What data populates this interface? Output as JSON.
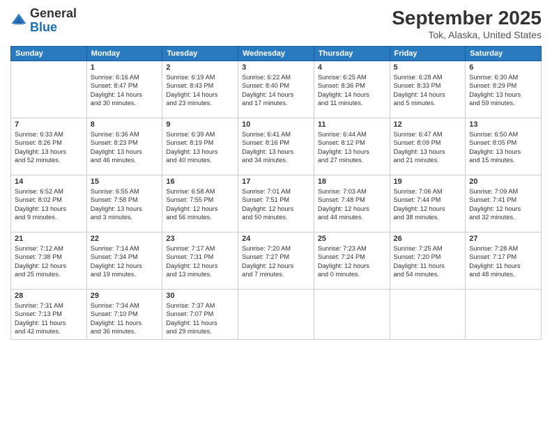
{
  "header": {
    "logo_general": "General",
    "logo_blue": "Blue",
    "title": "September 2025",
    "subtitle": "Tok, Alaska, United States"
  },
  "days_of_week": [
    "Sunday",
    "Monday",
    "Tuesday",
    "Wednesday",
    "Thursday",
    "Friday",
    "Saturday"
  ],
  "weeks": [
    [
      {
        "day": "",
        "info": ""
      },
      {
        "day": "1",
        "info": "Sunrise: 6:16 AM\nSunset: 8:47 PM\nDaylight: 14 hours\nand 30 minutes."
      },
      {
        "day": "2",
        "info": "Sunrise: 6:19 AM\nSunset: 8:43 PM\nDaylight: 14 hours\nand 23 minutes."
      },
      {
        "day": "3",
        "info": "Sunrise: 6:22 AM\nSunset: 8:40 PM\nDaylight: 14 hours\nand 17 minutes."
      },
      {
        "day": "4",
        "info": "Sunrise: 6:25 AM\nSunset: 8:36 PM\nDaylight: 14 hours\nand 11 minutes."
      },
      {
        "day": "5",
        "info": "Sunrise: 6:28 AM\nSunset: 8:33 PM\nDaylight: 14 hours\nand 5 minutes."
      },
      {
        "day": "6",
        "info": "Sunrise: 6:30 AM\nSunset: 8:29 PM\nDaylight: 13 hours\nand 59 minutes."
      }
    ],
    [
      {
        "day": "7",
        "info": "Sunrise: 6:33 AM\nSunset: 8:26 PM\nDaylight: 13 hours\nand 52 minutes."
      },
      {
        "day": "8",
        "info": "Sunrise: 6:36 AM\nSunset: 8:23 PM\nDaylight: 13 hours\nand 46 minutes."
      },
      {
        "day": "9",
        "info": "Sunrise: 6:39 AM\nSunset: 8:19 PM\nDaylight: 13 hours\nand 40 minutes."
      },
      {
        "day": "10",
        "info": "Sunrise: 6:41 AM\nSunset: 8:16 PM\nDaylight: 13 hours\nand 34 minutes."
      },
      {
        "day": "11",
        "info": "Sunrise: 6:44 AM\nSunset: 8:12 PM\nDaylight: 13 hours\nand 27 minutes."
      },
      {
        "day": "12",
        "info": "Sunrise: 6:47 AM\nSunset: 8:09 PM\nDaylight: 13 hours\nand 21 minutes."
      },
      {
        "day": "13",
        "info": "Sunrise: 6:50 AM\nSunset: 8:05 PM\nDaylight: 13 hours\nand 15 minutes."
      }
    ],
    [
      {
        "day": "14",
        "info": "Sunrise: 6:52 AM\nSunset: 8:02 PM\nDaylight: 13 hours\nand 9 minutes."
      },
      {
        "day": "15",
        "info": "Sunrise: 6:55 AM\nSunset: 7:58 PM\nDaylight: 13 hours\nand 3 minutes."
      },
      {
        "day": "16",
        "info": "Sunrise: 6:58 AM\nSunset: 7:55 PM\nDaylight: 12 hours\nand 56 minutes."
      },
      {
        "day": "17",
        "info": "Sunrise: 7:01 AM\nSunset: 7:51 PM\nDaylight: 12 hours\nand 50 minutes."
      },
      {
        "day": "18",
        "info": "Sunrise: 7:03 AM\nSunset: 7:48 PM\nDaylight: 12 hours\nand 44 minutes."
      },
      {
        "day": "19",
        "info": "Sunrise: 7:06 AM\nSunset: 7:44 PM\nDaylight: 12 hours\nand 38 minutes."
      },
      {
        "day": "20",
        "info": "Sunrise: 7:09 AM\nSunset: 7:41 PM\nDaylight: 12 hours\nand 32 minutes."
      }
    ],
    [
      {
        "day": "21",
        "info": "Sunrise: 7:12 AM\nSunset: 7:38 PM\nDaylight: 12 hours\nand 25 minutes."
      },
      {
        "day": "22",
        "info": "Sunrise: 7:14 AM\nSunset: 7:34 PM\nDaylight: 12 hours\nand 19 minutes."
      },
      {
        "day": "23",
        "info": "Sunrise: 7:17 AM\nSunset: 7:31 PM\nDaylight: 12 hours\nand 13 minutes."
      },
      {
        "day": "24",
        "info": "Sunrise: 7:20 AM\nSunset: 7:27 PM\nDaylight: 12 hours\nand 7 minutes."
      },
      {
        "day": "25",
        "info": "Sunrise: 7:23 AM\nSunset: 7:24 PM\nDaylight: 12 hours\nand 0 minutes."
      },
      {
        "day": "26",
        "info": "Sunrise: 7:25 AM\nSunset: 7:20 PM\nDaylight: 11 hours\nand 54 minutes."
      },
      {
        "day": "27",
        "info": "Sunrise: 7:28 AM\nSunset: 7:17 PM\nDaylight: 11 hours\nand 48 minutes."
      }
    ],
    [
      {
        "day": "28",
        "info": "Sunrise: 7:31 AM\nSunset: 7:13 PM\nDaylight: 11 hours\nand 42 minutes."
      },
      {
        "day": "29",
        "info": "Sunrise: 7:34 AM\nSunset: 7:10 PM\nDaylight: 11 hours\nand 36 minutes."
      },
      {
        "day": "30",
        "info": "Sunrise: 7:37 AM\nSunset: 7:07 PM\nDaylight: 11 hours\nand 29 minutes."
      },
      {
        "day": "",
        "info": ""
      },
      {
        "day": "",
        "info": ""
      },
      {
        "day": "",
        "info": ""
      },
      {
        "day": "",
        "info": ""
      }
    ]
  ]
}
